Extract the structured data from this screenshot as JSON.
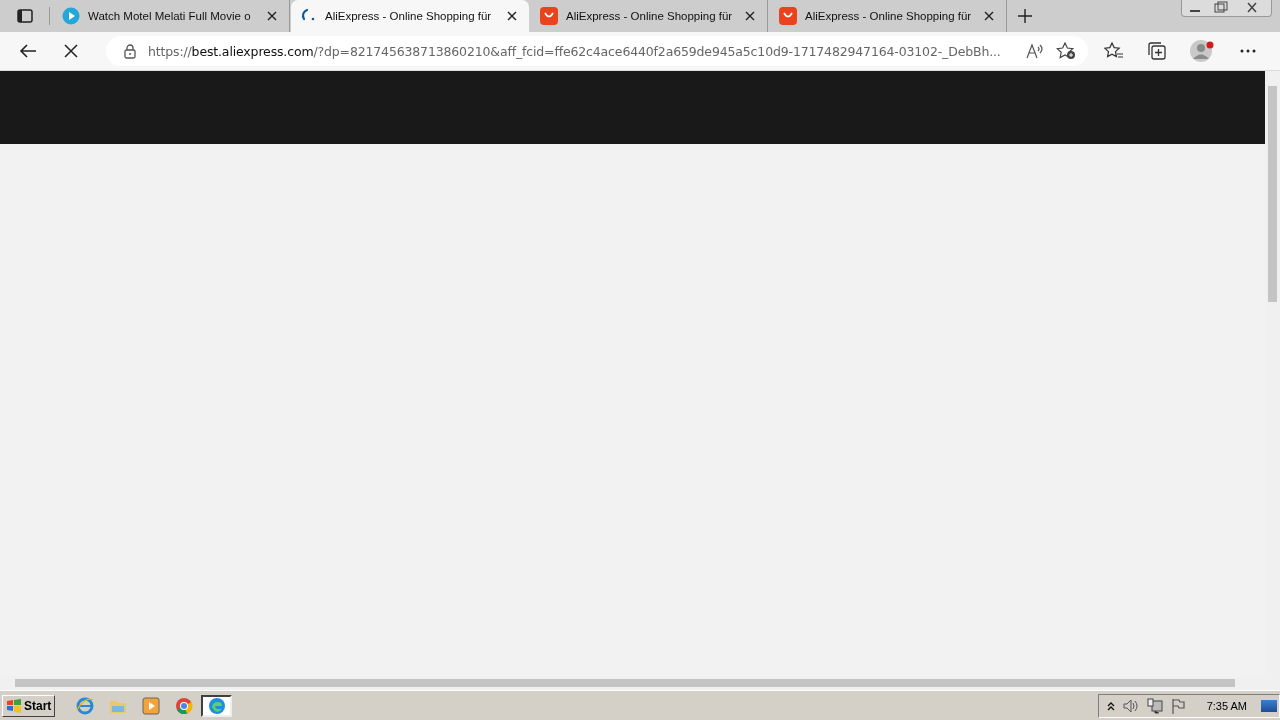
{
  "tabs": [
    {
      "title": "Watch Motel Melati Full Movie o",
      "kind": "play",
      "selected": false
    },
    {
      "title": "AliExpress - Online Shopping für",
      "kind": "spinner",
      "selected": true
    },
    {
      "title": "AliExpress - Online Shopping für",
      "kind": "bag",
      "selected": false
    },
    {
      "title": "AliExpress - Online Shopping für",
      "kind": "bag",
      "selected": false
    }
  ],
  "address": {
    "scheme": "https://",
    "host": "best.aliexpress.com",
    "rest": "/?dp=821745638713860210&aff_fcid=ffe62c4ace6440f2a659de945a5c10d9-1717482947164-03102-_DebBh..."
  },
  "taskbar": {
    "start": "Start",
    "apps": [
      {
        "kind": "ie",
        "selected": false
      },
      {
        "kind": "folder",
        "selected": false
      },
      {
        "kind": "media",
        "selected": false
      },
      {
        "kind": "chrome",
        "selected": false
      },
      {
        "kind": "edge",
        "selected": true
      }
    ],
    "clock": "7:35 AM"
  }
}
